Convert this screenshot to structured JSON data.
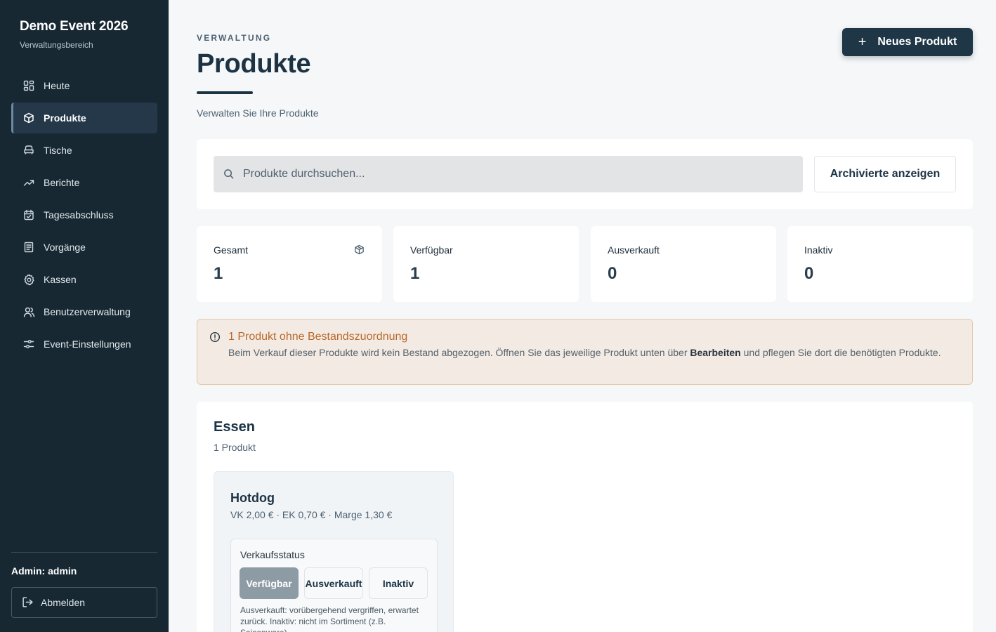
{
  "sidebar": {
    "title": "Demo Event 2026",
    "subtitle": "Verwaltungsbereich",
    "items": [
      {
        "label": "Heute",
        "icon": "layout-grid-icon"
      },
      {
        "label": "Produkte",
        "icon": "package-icon",
        "active": true
      },
      {
        "label": "Tische",
        "icon": "armchair-icon"
      },
      {
        "label": "Berichte",
        "icon": "trending-up-icon"
      },
      {
        "label": "Tagesabschluss",
        "icon": "calendar-check-icon"
      },
      {
        "label": "Vorgänge",
        "icon": "receipt-icon"
      },
      {
        "label": "Kassen",
        "icon": "gear-icon"
      },
      {
        "label": "Benutzerverwaltung",
        "icon": "users-icon"
      },
      {
        "label": "Event-Einstellungen",
        "icon": "sliders-icon"
      }
    ],
    "admin_label": "Admin: admin",
    "logout_label": "Abmelden"
  },
  "header": {
    "eyebrow": "VERWALTUNG",
    "title": "Produkte",
    "subtitle": "Verwalten Sie Ihre Produkte",
    "new_button": "Neues Produkt"
  },
  "search": {
    "placeholder": "Produkte durchsuchen...",
    "value": "",
    "archive_button": "Archivierte anzeigen"
  },
  "stats": [
    {
      "label": "Gesamt",
      "value": "1"
    },
    {
      "label": "Verfügbar",
      "value": "1"
    },
    {
      "label": "Ausverkauft",
      "value": "0"
    },
    {
      "label": "Inaktiv",
      "value": "0"
    }
  ],
  "alert": {
    "title": "1 Produkt ohne Bestandszuordnung",
    "text_before": "Beim Verkauf dieser Produkte wird kein Bestand abgezogen. Öffnen Sie das jeweilige Produkt unten über ",
    "text_bold": "Bearbeiten",
    "text_after": " und pflegen Sie dort die benötigten Produkte."
  },
  "section": {
    "title": "Essen",
    "count": "1 Produkt",
    "products": [
      {
        "name": "Hotdog",
        "prices": "VK 2,00 € · EK 0,70 € · Marge 1,30 €",
        "status_label": "Verkaufsstatus",
        "status_options": [
          "Verfügbar",
          "Ausverkauft",
          "Inaktiv"
        ],
        "status_selected": "Verfügbar",
        "status_hint": "Ausverkauft: vorübergehend vergriffen, erwartet zurück. Inaktiv: nicht im Sortiment (z.B. Saisonware)"
      }
    ]
  },
  "colors": {
    "sidebar_bg": "#172833",
    "primary": "#1e3646",
    "alert_title": "#b8682a",
    "alert_bg": "#f3ebe3"
  }
}
